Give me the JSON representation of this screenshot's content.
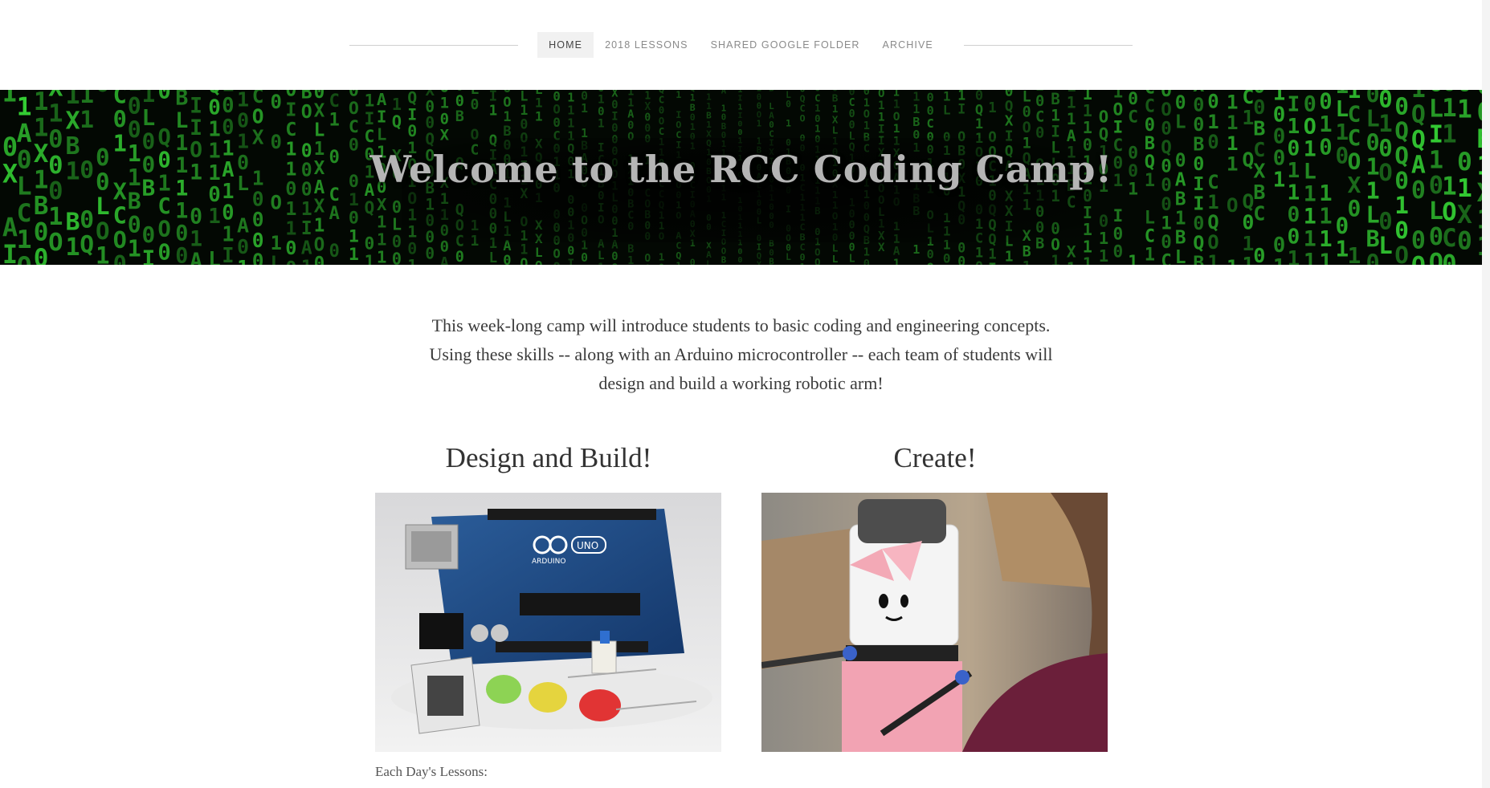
{
  "nav": {
    "items": [
      {
        "label": "HOME",
        "active": true
      },
      {
        "label": "2018 LESSONS",
        "active": false
      },
      {
        "label": "SHARED GOOGLE FOLDER",
        "active": false
      },
      {
        "label": "ARCHIVE",
        "active": false
      }
    ]
  },
  "hero": {
    "title": "Welcome to the RCC Coding Camp!"
  },
  "intro": {
    "lines": [
      "This week-long camp will introduce students to basic coding and engineering concepts.",
      "Using these skills -- along with an Arduino microcontroller -- each team of students will",
      "design and build a working robotic arm!"
    ]
  },
  "features": [
    {
      "heading": "Design and Build!",
      "image": "arduino-board-photo"
    },
    {
      "heading": "Create!",
      "image": "paper-robot-arm-photo"
    }
  ],
  "caption": "Each Day's Lessons:",
  "colors": {
    "matrix_green": "#35d435",
    "banner_bg": "#030803",
    "title_text": "#b5b5b5"
  }
}
